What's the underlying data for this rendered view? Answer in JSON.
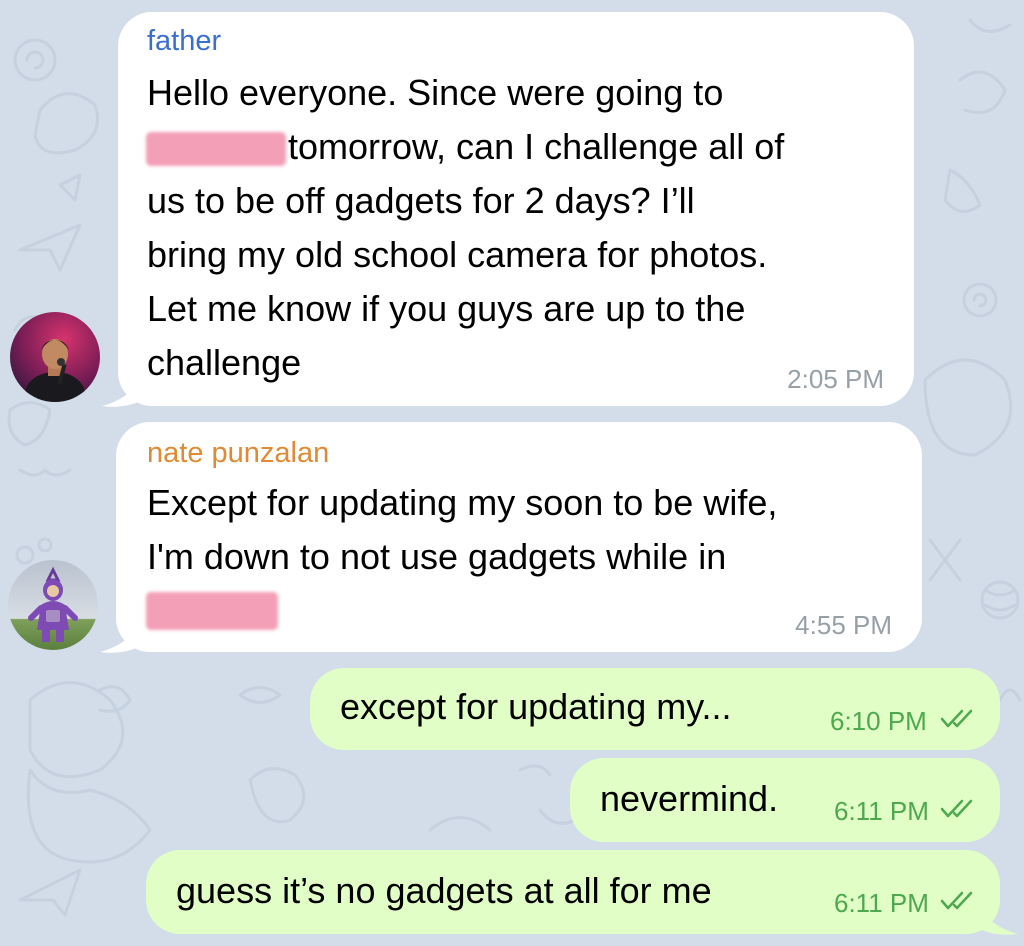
{
  "colors": {
    "wallpaper": "#d3dde9",
    "incoming_bubble": "#ffffff",
    "outgoing_bubble": "#e1fec6",
    "sender_father": "#3a6fd0",
    "sender_nate": "#e08a34",
    "time_in": "#98a0a7",
    "time_out": "#4da84e",
    "redaction": "#f49fb8"
  },
  "messages": [
    {
      "sender": "father",
      "lines": [
        "Hello everyone. Since were going to",
        "tomorrow, can I challenge all of",
        "us to be off gadgets for 2 days? I’ll",
        "bring my old school camera for photos.",
        "Let me know if you guys are up to the",
        "challenge"
      ],
      "time": "2:05 PM",
      "avatar_icon": "person-with-microphone-avatar"
    },
    {
      "sender": "nate punzalan",
      "lines": [
        "Except for updating my soon to be wife,",
        "I'm down to not use gadgets while in"
      ],
      "time": "4:55 PM",
      "avatar_icon": "purple-character-avatar"
    },
    {
      "text": "except for updating my...",
      "time": "6:10 PM",
      "status_icon": "double-check-icon"
    },
    {
      "text": "nevermind.",
      "time": "6:11 PM",
      "status_icon": "double-check-icon"
    },
    {
      "text": "guess it’s no gadgets at all for me",
      "time": "6:11 PM",
      "status_icon": "double-check-icon"
    }
  ]
}
